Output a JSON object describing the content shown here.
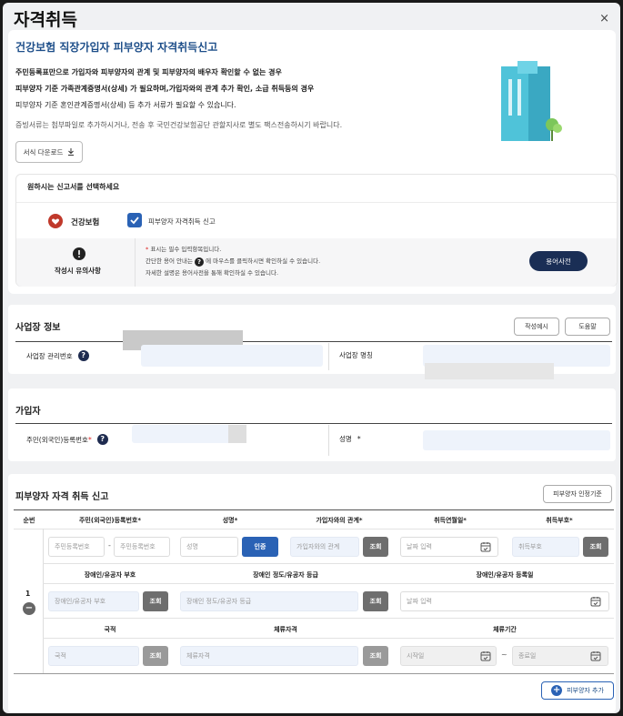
{
  "header": {
    "title": "자격취득",
    "close": "×"
  },
  "form": {
    "title": "건강보험 직장가입자 피부양자 자격취득신고",
    "notice_lines": [
      "주민등록표만으로 가입자와 피부양자의 관계 및 피부양자의 배우자 확인할 수 없는 경우",
      "피부양자 기준 가족관계증명서(상세) 가 필요하며,가입자와의 관계 추가 확인, 소급 취득등의 경우",
      "피부양자 기준 혼인관계증명서(상세) 등 추가 서류가 필요할 수 있습니다."
    ],
    "notice_extra": "증빙서류는 첨부파일로 추가하시거나, 전송 후 국민건강보험공단 관할지사로 별도 팩스전송하시기 바랍니다.",
    "download_label": "서식 다운로드"
  },
  "selection": {
    "prompt": "원하시는 신고서를 선택하세요",
    "insurance_label": "건강보험",
    "checkbox_label": "피부양자 자격취득 신고",
    "caution_label": "작성시 유의사항",
    "notes": [
      "표시는 필수 입력항목입니다.",
      "간단한 용어 안내는",
      "에 마우스를 클릭하시면 확인하실 수 있습니다.",
      "자세한 설명은 용어사전을 통해 확인하실 수 있습니다."
    ],
    "dictionary_btn": "용어사전"
  },
  "workplace": {
    "title": "사업장 정보",
    "example_btn": "작성예시",
    "help_btn": "도움말",
    "mgmt_no_label": "사업장 관리번호",
    "name_label": "사업장 명칭"
  },
  "subscriber": {
    "title": "가입자",
    "rrn_label": "주민(외국인)등록번호",
    "name_label": "성명"
  },
  "dependent": {
    "title": "피부양자 자격 취득 신고",
    "criteria_btn": "피부양자 인정기준",
    "headers_row1": [
      "순번",
      "주민(외국인)등록번호*",
      "성명*",
      "가입자와의 관계*",
      "취득연월일*",
      "취득부호*"
    ],
    "headers_row2": [
      "장애인/유공자 부호",
      "장애인 정도/유공자 등급",
      "장애인/유공자 등록일"
    ],
    "headers_row3": [
      "국적",
      "체류자격",
      "체류기간"
    ],
    "row_no": "1",
    "ph": {
      "rrn1": "주민등록번호",
      "dash": "-",
      "rrn2": "주민등록번호",
      "name": "성명",
      "relation": "가입자와의 관계",
      "acq_date": "날짜 입력",
      "acq_code": "취득부호",
      "dis_code": "장애인/유공자 부호",
      "dis_grade": "장애인 정도/유공자 등급",
      "dis_date": "날짜 입력",
      "nation": "국적",
      "stay_status": "체류자격",
      "start": "시작일",
      "tilde": "~",
      "end": "종료일"
    },
    "btn_verify": "인증",
    "btn_lookup": "조회",
    "add_btn": "피부양자 추가"
  },
  "colors": {
    "accent": "#2a62b5",
    "title_blue": "#1d4e89",
    "dark_navy": "#1a2e55",
    "required": "#dd2222"
  }
}
